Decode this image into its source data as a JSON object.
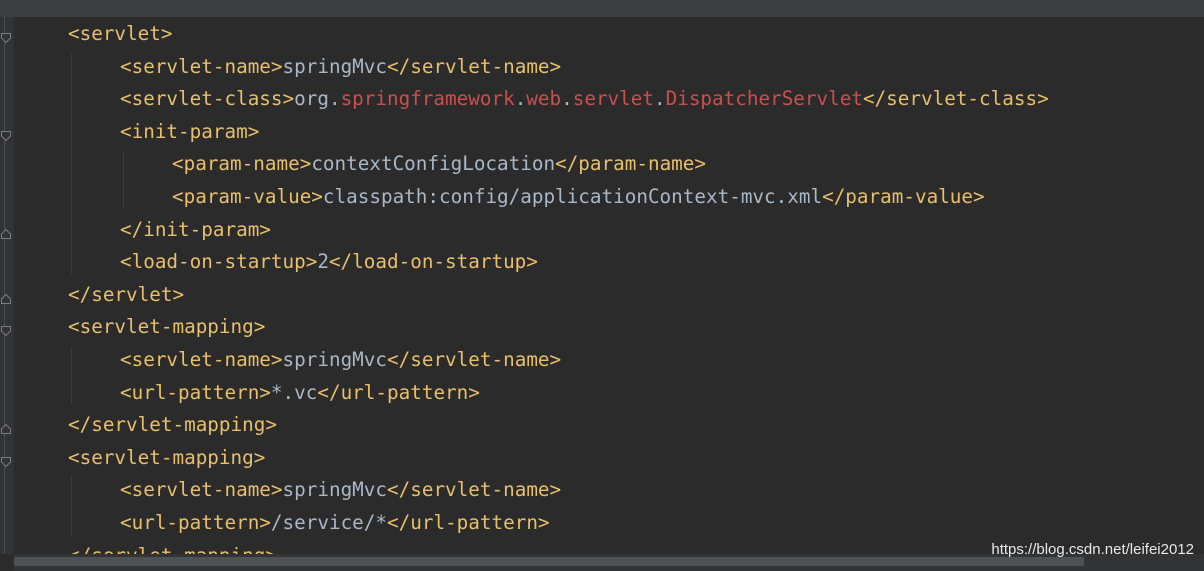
{
  "editor": {
    "lines": [
      {
        "indent": 1,
        "parts": [
          {
            "cls": "tag",
            "text": "<servlet>"
          }
        ]
      },
      {
        "indent": 2,
        "parts": [
          {
            "cls": "tag",
            "text": "<servlet-name>"
          },
          {
            "cls": "txt",
            "text": "springMvc"
          },
          {
            "cls": "tag",
            "text": "</servlet-name>"
          }
        ]
      },
      {
        "indent": 2,
        "parts": [
          {
            "cls": "tag",
            "text": "<servlet-class>"
          },
          {
            "cls": "txt",
            "text": "org."
          },
          {
            "cls": "pkg",
            "text": "springframework"
          },
          {
            "cls": "txt",
            "text": "."
          },
          {
            "cls": "pkg",
            "text": "web"
          },
          {
            "cls": "txt",
            "text": "."
          },
          {
            "cls": "pkg",
            "text": "servlet"
          },
          {
            "cls": "txt",
            "text": "."
          },
          {
            "cls": "pkg",
            "text": "DispatcherServlet"
          },
          {
            "cls": "tag",
            "text": "</servlet-class>"
          }
        ]
      },
      {
        "indent": 2,
        "parts": [
          {
            "cls": "tag",
            "text": "<init-param>"
          }
        ]
      },
      {
        "indent": 3,
        "parts": [
          {
            "cls": "tag",
            "text": "<param-name>"
          },
          {
            "cls": "txt",
            "text": "contextConfigLocation"
          },
          {
            "cls": "tag",
            "text": "</param-name>"
          }
        ]
      },
      {
        "indent": 3,
        "parts": [
          {
            "cls": "tag",
            "text": "<param-value>"
          },
          {
            "cls": "txt",
            "text": "classpath:config/applicationContext-mvc.xml"
          },
          {
            "cls": "tag",
            "text": "</param-value>"
          }
        ]
      },
      {
        "indent": 2,
        "parts": [
          {
            "cls": "tag",
            "text": "</init-param>"
          }
        ]
      },
      {
        "indent": 2,
        "parts": [
          {
            "cls": "tag",
            "text": "<load-on-startup>"
          },
          {
            "cls": "txt",
            "text": "2"
          },
          {
            "cls": "tag",
            "text": "</load-on-startup>"
          }
        ]
      },
      {
        "indent": 1,
        "parts": [
          {
            "cls": "tag",
            "text": "</servlet>"
          }
        ]
      },
      {
        "indent": 1,
        "parts": [
          {
            "cls": "tag",
            "text": "<servlet-mapping>"
          }
        ]
      },
      {
        "indent": 2,
        "parts": [
          {
            "cls": "tag",
            "text": "<servlet-name>"
          },
          {
            "cls": "txt",
            "text": "springMvc"
          },
          {
            "cls": "tag",
            "text": "</servlet-name>"
          }
        ]
      },
      {
        "indent": 2,
        "parts": [
          {
            "cls": "tag",
            "text": "<url-pattern>"
          },
          {
            "cls": "txt",
            "text": "*.vc"
          },
          {
            "cls": "tag",
            "text": "</url-pattern>"
          }
        ]
      },
      {
        "indent": 1,
        "parts": [
          {
            "cls": "tag",
            "text": "</servlet-mapping>"
          }
        ]
      },
      {
        "indent": 1,
        "parts": [
          {
            "cls": "tag",
            "text": "<servlet-mapping>"
          }
        ]
      },
      {
        "indent": 2,
        "parts": [
          {
            "cls": "tag",
            "text": "<servlet-name>"
          },
          {
            "cls": "txt",
            "text": "springMvc"
          },
          {
            "cls": "tag",
            "text": "</servlet-name>"
          }
        ]
      },
      {
        "indent": 2,
        "parts": [
          {
            "cls": "tag",
            "text": "<url-pattern>"
          },
          {
            "cls": "txt",
            "text": "/service/*"
          },
          {
            "cls": "tag",
            "text": "</url-pattern>"
          }
        ]
      },
      {
        "indent": 1,
        "parts": [
          {
            "cls": "tag",
            "text": "</servlet-mapping>"
          }
        ]
      }
    ],
    "fold_markers": [
      {
        "line": 0,
        "kind": "open"
      },
      {
        "line": 3,
        "kind": "open"
      },
      {
        "line": 6,
        "kind": "close"
      },
      {
        "line": 8,
        "kind": "close"
      },
      {
        "line": 9,
        "kind": "open"
      },
      {
        "line": 12,
        "kind": "close"
      },
      {
        "line": 13,
        "kind": "open"
      },
      {
        "line": 16,
        "kind": "close"
      }
    ]
  },
  "colors": {
    "background": "#2b2b2b",
    "tag": "#e8bf6a",
    "text": "#a9b7c6",
    "package": "#cc4e4e"
  },
  "watermark": "https://blog.csdn.net/leifei2012"
}
